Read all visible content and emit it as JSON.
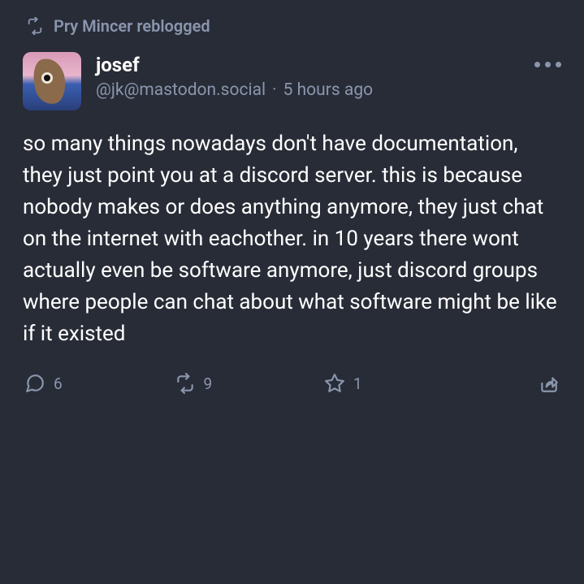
{
  "reblog": {
    "by": "Pry Mincer reblogged"
  },
  "post": {
    "author": {
      "display_name": "josef",
      "handle": "@jk@mastodon.social"
    },
    "timestamp": "5 hours ago",
    "body": "so many things nowadays don't have documentation, they just point you at a discord server. this is because nobody makes or does anything anymore, they just chat on the internet with eachother. in 10 years there wont actually even be software anymore, just discord groups where people can chat about what software might be like if it existed"
  },
  "actions": {
    "reply_count": "6",
    "boost_count": "9",
    "favorite_count": "1"
  }
}
